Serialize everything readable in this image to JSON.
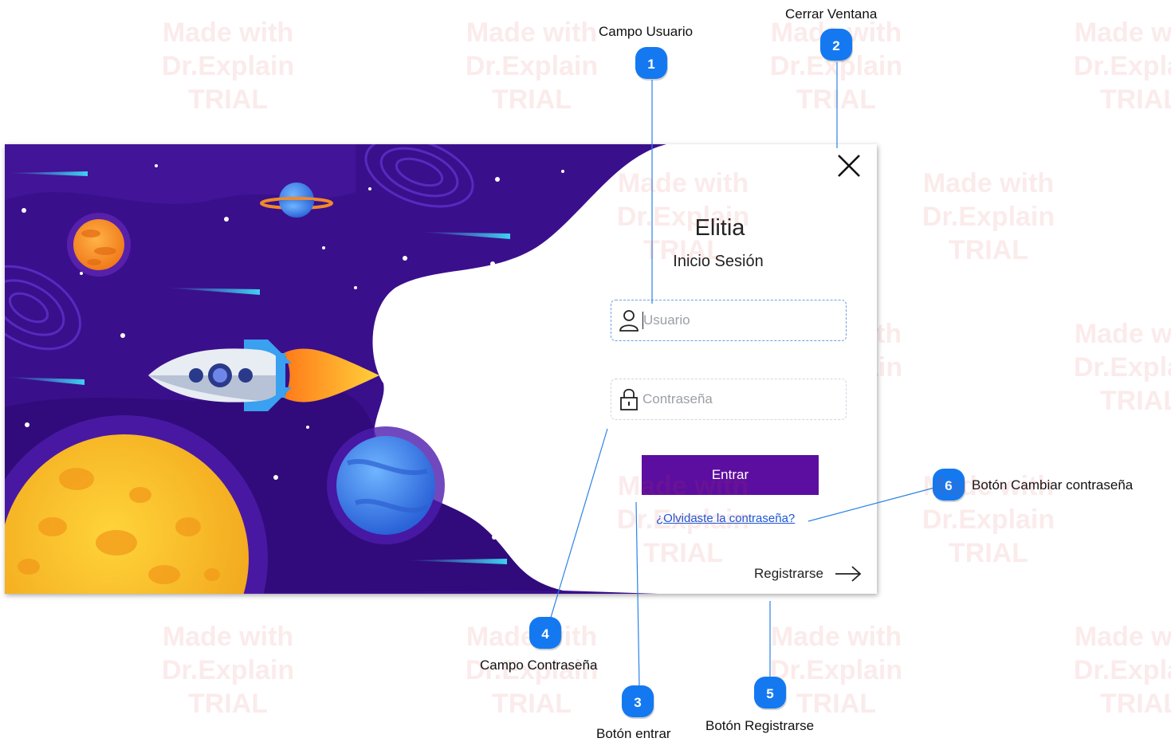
{
  "watermark": {
    "line1": "Made with",
    "line2": "Dr.Explain",
    "line3": "TRIAL"
  },
  "login_window": {
    "app_title": "Elitia",
    "subtitle": "Inicio Sesión",
    "username": {
      "placeholder": "Usuario",
      "value": "",
      "icon": "user-icon"
    },
    "password": {
      "placeholder": "Contraseña",
      "value": "",
      "icon": "lock-icon"
    },
    "enter_label": "Entrar",
    "forgot_label": "¿Olvidaste la contraseña?",
    "register_label": "Registrarse",
    "register_icon": "arrow-right-icon",
    "close_icon": "close-icon",
    "colors": {
      "accent": "#5c0ea0",
      "link": "#1a56d6",
      "space_bg": "#3a0f8c"
    }
  },
  "callouts": [
    {
      "number": "1",
      "label": "Campo Usuario"
    },
    {
      "number": "2",
      "label": "Cerrar Ventana"
    },
    {
      "number": "3",
      "label": "Botón entrar"
    },
    {
      "number": "4",
      "label": "Campo Contraseña"
    },
    {
      "number": "5",
      "label": "Botón  Registrarse"
    },
    {
      "number": "6",
      "label": "Botón Cambiar contraseña"
    }
  ],
  "colors": {
    "badge": "#1479f0",
    "leader_line": "#2a82e8"
  }
}
